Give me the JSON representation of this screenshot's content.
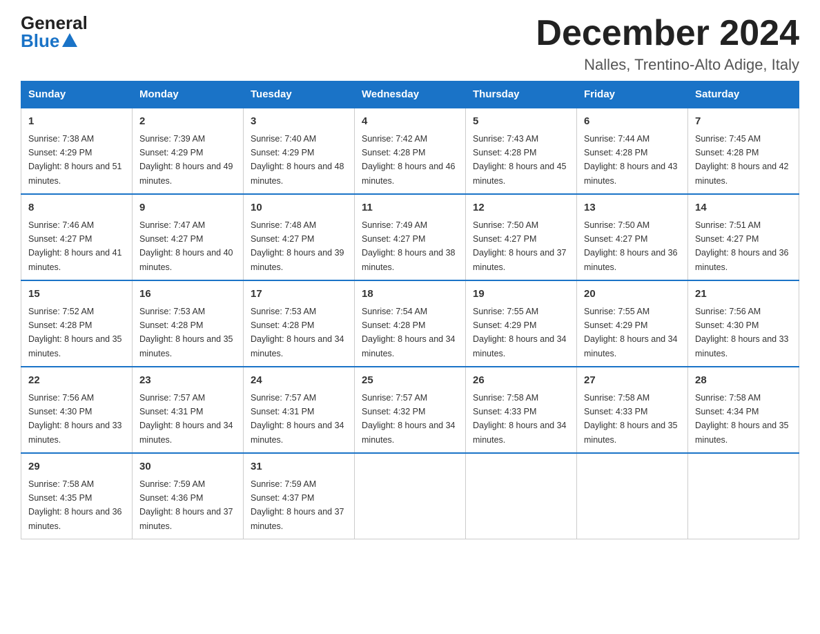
{
  "logo": {
    "general": "General",
    "blue": "Blue"
  },
  "header": {
    "month": "December 2024",
    "location": "Nalles, Trentino-Alto Adige, Italy"
  },
  "weekdays": [
    "Sunday",
    "Monday",
    "Tuesday",
    "Wednesday",
    "Thursday",
    "Friday",
    "Saturday"
  ],
  "weeks": [
    [
      {
        "day": "1",
        "sunrise": "Sunrise: 7:38 AM",
        "sunset": "Sunset: 4:29 PM",
        "daylight": "Daylight: 8 hours and 51 minutes."
      },
      {
        "day": "2",
        "sunrise": "Sunrise: 7:39 AM",
        "sunset": "Sunset: 4:29 PM",
        "daylight": "Daylight: 8 hours and 49 minutes."
      },
      {
        "day": "3",
        "sunrise": "Sunrise: 7:40 AM",
        "sunset": "Sunset: 4:29 PM",
        "daylight": "Daylight: 8 hours and 48 minutes."
      },
      {
        "day": "4",
        "sunrise": "Sunrise: 7:42 AM",
        "sunset": "Sunset: 4:28 PM",
        "daylight": "Daylight: 8 hours and 46 minutes."
      },
      {
        "day": "5",
        "sunrise": "Sunrise: 7:43 AM",
        "sunset": "Sunset: 4:28 PM",
        "daylight": "Daylight: 8 hours and 45 minutes."
      },
      {
        "day": "6",
        "sunrise": "Sunrise: 7:44 AM",
        "sunset": "Sunset: 4:28 PM",
        "daylight": "Daylight: 8 hours and 43 minutes."
      },
      {
        "day": "7",
        "sunrise": "Sunrise: 7:45 AM",
        "sunset": "Sunset: 4:28 PM",
        "daylight": "Daylight: 8 hours and 42 minutes."
      }
    ],
    [
      {
        "day": "8",
        "sunrise": "Sunrise: 7:46 AM",
        "sunset": "Sunset: 4:27 PM",
        "daylight": "Daylight: 8 hours and 41 minutes."
      },
      {
        "day": "9",
        "sunrise": "Sunrise: 7:47 AM",
        "sunset": "Sunset: 4:27 PM",
        "daylight": "Daylight: 8 hours and 40 minutes."
      },
      {
        "day": "10",
        "sunrise": "Sunrise: 7:48 AM",
        "sunset": "Sunset: 4:27 PM",
        "daylight": "Daylight: 8 hours and 39 minutes."
      },
      {
        "day": "11",
        "sunrise": "Sunrise: 7:49 AM",
        "sunset": "Sunset: 4:27 PM",
        "daylight": "Daylight: 8 hours and 38 minutes."
      },
      {
        "day": "12",
        "sunrise": "Sunrise: 7:50 AM",
        "sunset": "Sunset: 4:27 PM",
        "daylight": "Daylight: 8 hours and 37 minutes."
      },
      {
        "day": "13",
        "sunrise": "Sunrise: 7:50 AM",
        "sunset": "Sunset: 4:27 PM",
        "daylight": "Daylight: 8 hours and 36 minutes."
      },
      {
        "day": "14",
        "sunrise": "Sunrise: 7:51 AM",
        "sunset": "Sunset: 4:27 PM",
        "daylight": "Daylight: 8 hours and 36 minutes."
      }
    ],
    [
      {
        "day": "15",
        "sunrise": "Sunrise: 7:52 AM",
        "sunset": "Sunset: 4:28 PM",
        "daylight": "Daylight: 8 hours and 35 minutes."
      },
      {
        "day": "16",
        "sunrise": "Sunrise: 7:53 AM",
        "sunset": "Sunset: 4:28 PM",
        "daylight": "Daylight: 8 hours and 35 minutes."
      },
      {
        "day": "17",
        "sunrise": "Sunrise: 7:53 AM",
        "sunset": "Sunset: 4:28 PM",
        "daylight": "Daylight: 8 hours and 34 minutes."
      },
      {
        "day": "18",
        "sunrise": "Sunrise: 7:54 AM",
        "sunset": "Sunset: 4:28 PM",
        "daylight": "Daylight: 8 hours and 34 minutes."
      },
      {
        "day": "19",
        "sunrise": "Sunrise: 7:55 AM",
        "sunset": "Sunset: 4:29 PM",
        "daylight": "Daylight: 8 hours and 34 minutes."
      },
      {
        "day": "20",
        "sunrise": "Sunrise: 7:55 AM",
        "sunset": "Sunset: 4:29 PM",
        "daylight": "Daylight: 8 hours and 34 minutes."
      },
      {
        "day": "21",
        "sunrise": "Sunrise: 7:56 AM",
        "sunset": "Sunset: 4:30 PM",
        "daylight": "Daylight: 8 hours and 33 minutes."
      }
    ],
    [
      {
        "day": "22",
        "sunrise": "Sunrise: 7:56 AM",
        "sunset": "Sunset: 4:30 PM",
        "daylight": "Daylight: 8 hours and 33 minutes."
      },
      {
        "day": "23",
        "sunrise": "Sunrise: 7:57 AM",
        "sunset": "Sunset: 4:31 PM",
        "daylight": "Daylight: 8 hours and 34 minutes."
      },
      {
        "day": "24",
        "sunrise": "Sunrise: 7:57 AM",
        "sunset": "Sunset: 4:31 PM",
        "daylight": "Daylight: 8 hours and 34 minutes."
      },
      {
        "day": "25",
        "sunrise": "Sunrise: 7:57 AM",
        "sunset": "Sunset: 4:32 PM",
        "daylight": "Daylight: 8 hours and 34 minutes."
      },
      {
        "day": "26",
        "sunrise": "Sunrise: 7:58 AM",
        "sunset": "Sunset: 4:33 PM",
        "daylight": "Daylight: 8 hours and 34 minutes."
      },
      {
        "day": "27",
        "sunrise": "Sunrise: 7:58 AM",
        "sunset": "Sunset: 4:33 PM",
        "daylight": "Daylight: 8 hours and 35 minutes."
      },
      {
        "day": "28",
        "sunrise": "Sunrise: 7:58 AM",
        "sunset": "Sunset: 4:34 PM",
        "daylight": "Daylight: 8 hours and 35 minutes."
      }
    ],
    [
      {
        "day": "29",
        "sunrise": "Sunrise: 7:58 AM",
        "sunset": "Sunset: 4:35 PM",
        "daylight": "Daylight: 8 hours and 36 minutes."
      },
      {
        "day": "30",
        "sunrise": "Sunrise: 7:59 AM",
        "sunset": "Sunset: 4:36 PM",
        "daylight": "Daylight: 8 hours and 37 minutes."
      },
      {
        "day": "31",
        "sunrise": "Sunrise: 7:59 AM",
        "sunset": "Sunset: 4:37 PM",
        "daylight": "Daylight: 8 hours and 37 minutes."
      },
      null,
      null,
      null,
      null
    ]
  ]
}
